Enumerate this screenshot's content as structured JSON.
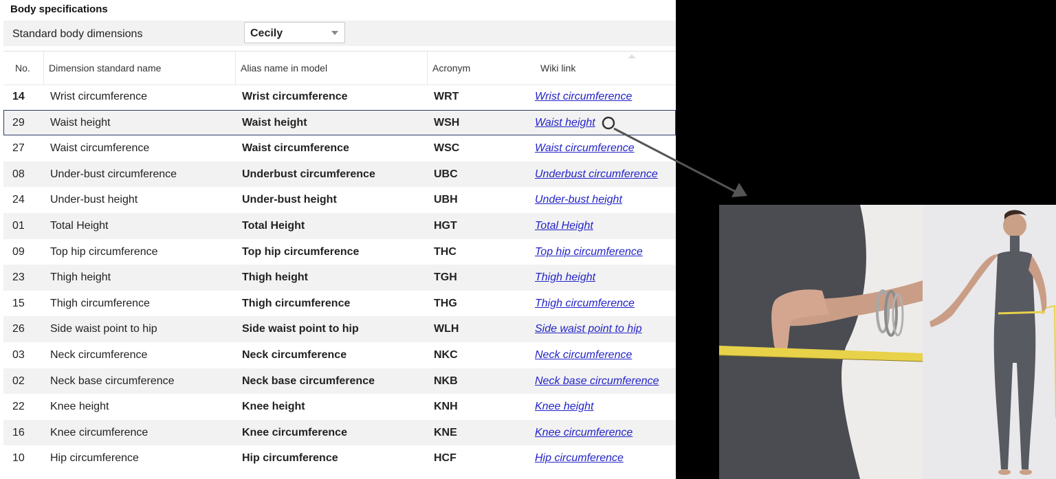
{
  "panel": {
    "title": "Body specifications",
    "standard_label": "Standard body dimensions",
    "standard_value": "Cecily"
  },
  "columns": [
    "No.",
    "Dimension standard name",
    "Alias name in model",
    "Acronym",
    "Wiki link"
  ],
  "rows": [
    {
      "no": "14",
      "name": "Wrist circumference",
      "alias": "Wrist circumference",
      "acronym": "WRT",
      "wiki": "Wrist circumference"
    },
    {
      "no": "29",
      "name": "Waist height",
      "alias": "Waist height",
      "acronym": "WSH",
      "wiki": "Waist height"
    },
    {
      "no": "27",
      "name": "Waist circumference",
      "alias": "Waist circumference",
      "acronym": "WSC",
      "wiki": "Waist circumference"
    },
    {
      "no": "08",
      "name": "Under-bust circumference",
      "alias": "Underbust circumference",
      "acronym": "UBC",
      "wiki": "Underbust circumference"
    },
    {
      "no": "24",
      "name": "Under-bust height",
      "alias": "Under-bust height",
      "acronym": "UBH",
      "wiki": "Under-bust height"
    },
    {
      "no": "01",
      "name": "Total Height",
      "alias": "Total Height",
      "acronym": "HGT",
      "wiki": "Total Height"
    },
    {
      "no": "09",
      "name": "Top hip circumference",
      "alias": "Top hip circumference",
      "acronym": "THC",
      "wiki": "Top hip circumference"
    },
    {
      "no": "23",
      "name": "Thigh height",
      "alias": "Thigh height",
      "acronym": "TGH",
      "wiki": "Thigh height"
    },
    {
      "no": "15",
      "name": "Thigh circumference",
      "alias": "Thigh circumference",
      "acronym": "THG",
      "wiki": "Thigh circumference"
    },
    {
      "no": "26",
      "name": "Side waist point to hip",
      "alias": "Side waist point to hip",
      "acronym": "WLH",
      "wiki": "Side waist point to hip"
    },
    {
      "no": "03",
      "name": "Neck circumference",
      "alias": "Neck circumference",
      "acronym": "NKC",
      "wiki": "Neck circumference"
    },
    {
      "no": "02",
      "name": "Neck base circumference",
      "alias": "Neck base circumference",
      "acronym": "NKB",
      "wiki": "Neck base circumference"
    },
    {
      "no": "22",
      "name": "Knee height",
      "alias": "Knee height",
      "acronym": "KNH",
      "wiki": "Knee height"
    },
    {
      "no": "16",
      "name": "Knee circumference",
      "alias": "Knee circumference",
      "acronym": "KNE",
      "wiki": "Knee circumference"
    },
    {
      "no": "10",
      "name": "Hip circumference",
      "alias": "Hip circumference",
      "acronym": "HCF",
      "wiki": "Hip circumference"
    }
  ],
  "selected_row": "29",
  "photo": {
    "icon": "waist-measurement-photo"
  },
  "colors": {
    "link": "#2323c8",
    "selection_border": "#2c3a66",
    "stripe": "#f2f2f2",
    "background": "#000000"
  }
}
